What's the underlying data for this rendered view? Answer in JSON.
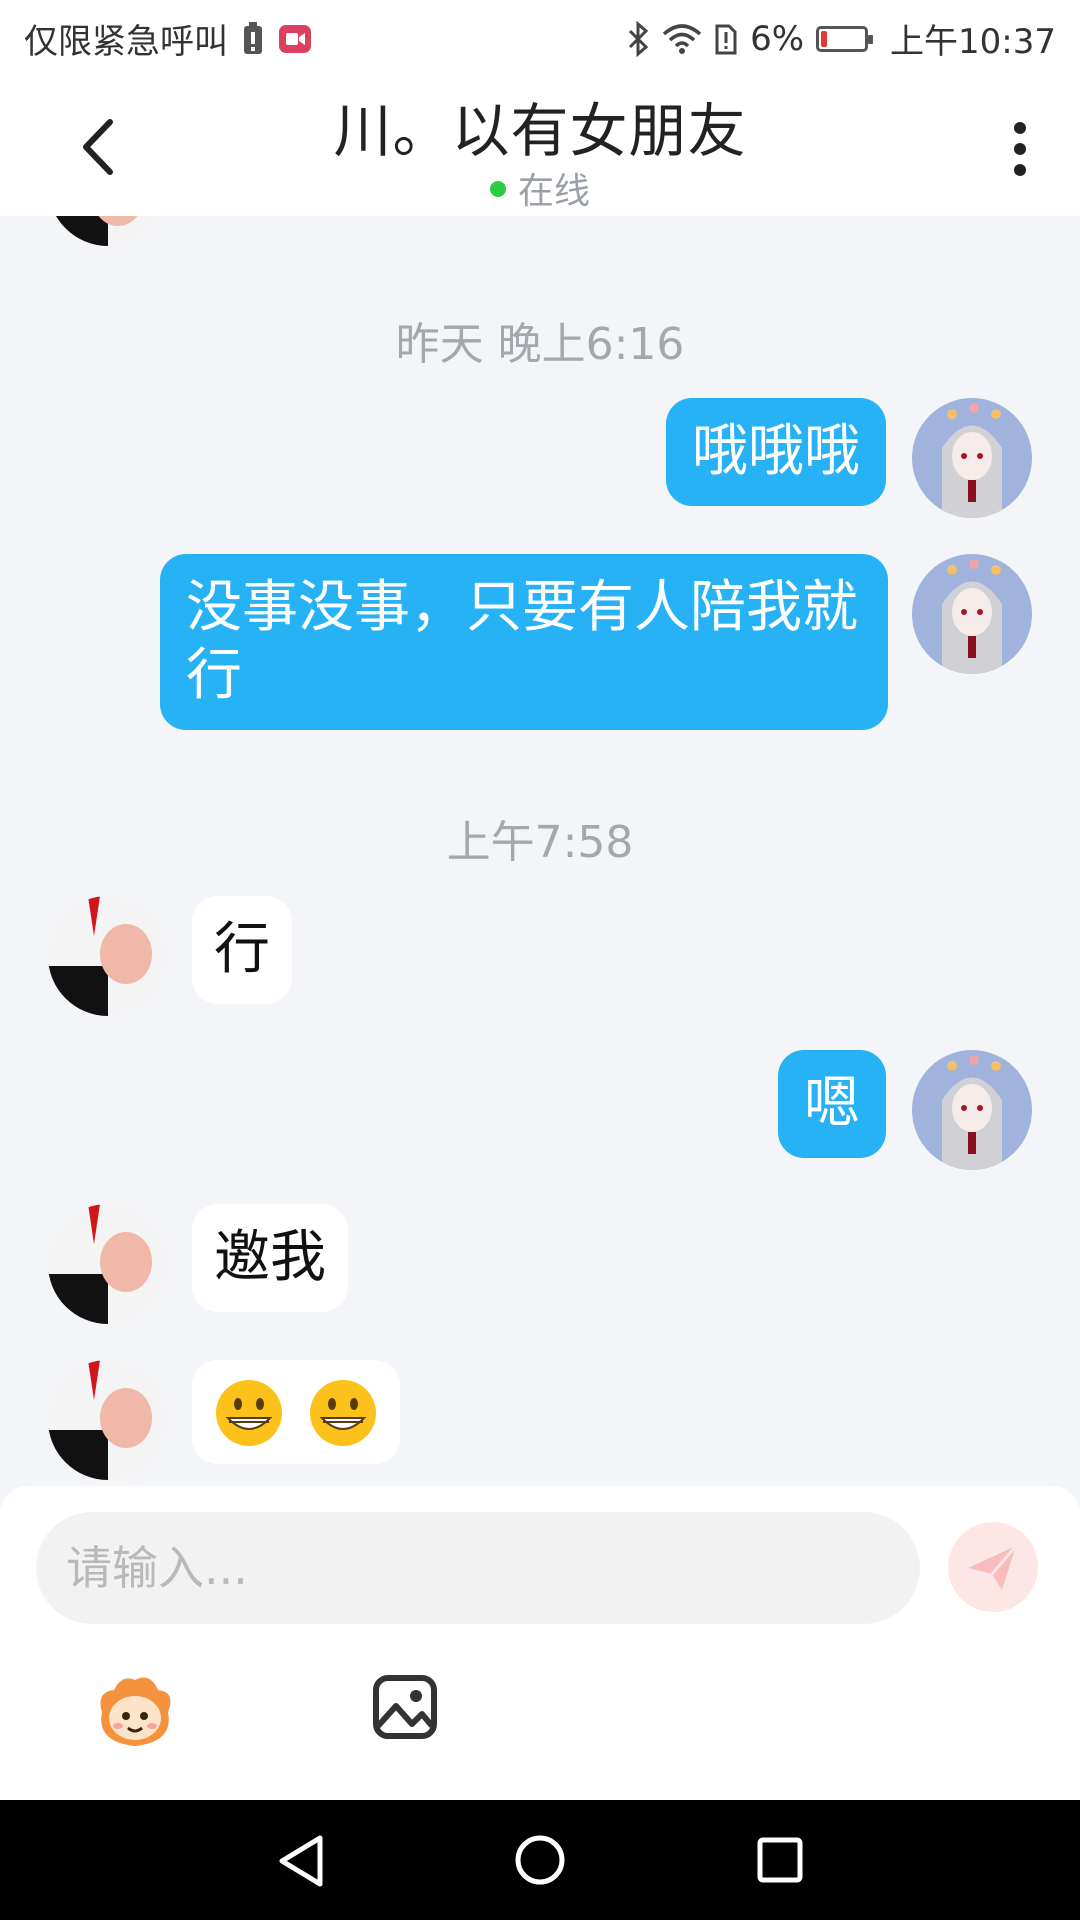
{
  "status_bar": {
    "carrier_text": "仅限紧急呼叫",
    "battery_percent": "6%",
    "time": "上午10:37"
  },
  "header": {
    "title": "川。以有女朋友",
    "presence": "在线"
  },
  "timestamps": {
    "yesterday": "昨天 晚上6:16",
    "morning": "上午7:58"
  },
  "messages": [
    {
      "side": "out",
      "text": "哦哦哦"
    },
    {
      "side": "out",
      "text": "没事没事，只要有人陪我就行"
    },
    {
      "side": "in",
      "text": "行"
    },
    {
      "side": "out",
      "text": "嗯"
    },
    {
      "side": "in",
      "text": "邀我"
    },
    {
      "side": "in",
      "emoji": [
        "grinning-face",
        "grinning-face"
      ]
    }
  ],
  "composer": {
    "placeholder": "请输入..."
  },
  "colors": {
    "outgoing_bubble": "#27b2f5",
    "incoming_bubble": "#ffffff",
    "online_dot": "#2ecc40",
    "send_button": "#fde7e6"
  },
  "icons": [
    "back-arrow-icon",
    "more-options-icon",
    "bluetooth-icon",
    "wifi-icon",
    "sim-alert-icon",
    "battery-icon",
    "emoji-mascot-icon",
    "image-icon",
    "send-icon",
    "nav-back-icon",
    "nav-home-icon",
    "nav-recents-icon"
  ]
}
